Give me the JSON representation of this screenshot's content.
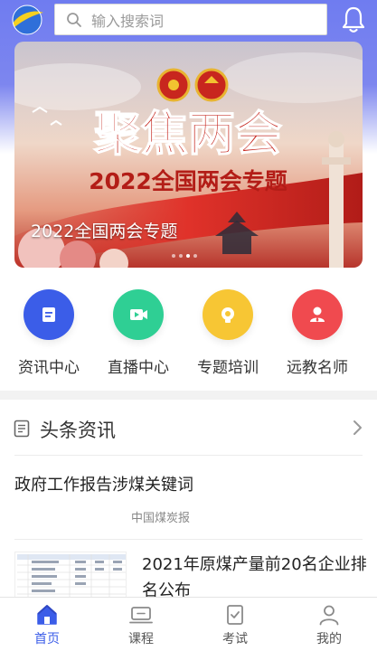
{
  "search": {
    "placeholder": "输入搜索词"
  },
  "banner": {
    "headline": "聚焦两会",
    "subline": "2022全国两会专题",
    "caption": "2022全国两会专题",
    "slides": 4,
    "active_slide": 2
  },
  "nav": [
    {
      "label": "资讯中心",
      "icon": "news-icon",
      "color": "#3b5de8"
    },
    {
      "label": "直播中心",
      "icon": "video-icon",
      "color": "#2fcf94"
    },
    {
      "label": "专题培训",
      "icon": "training-icon",
      "color": "#f7c634"
    },
    {
      "label": "远教名师",
      "icon": "teacher-icon",
      "color": "#f04a4f"
    }
  ],
  "section": {
    "title": "头条资讯"
  },
  "news": [
    {
      "title": "政府工作报告涉煤关键词",
      "source": "中国煤炭报"
    },
    {
      "title": "2021年原煤产量前20名企业排名公布"
    }
  ],
  "tabs": [
    {
      "label": "首页",
      "icon": "home-icon",
      "active": true
    },
    {
      "label": "课程",
      "icon": "course-icon",
      "active": false
    },
    {
      "label": "考试",
      "icon": "exam-icon",
      "active": false
    },
    {
      "label": "我的",
      "icon": "profile-icon",
      "active": false
    }
  ],
  "colors": {
    "accent": "#6f7cf0",
    "tab_active": "#3b5de8"
  }
}
